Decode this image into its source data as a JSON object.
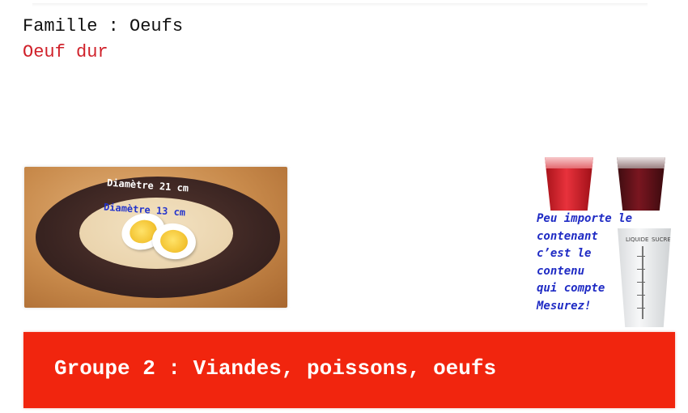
{
  "header": {
    "famille": "Famille : Oeufs",
    "recipe": "Oeuf dur"
  },
  "photo": {
    "diameter_outer": "Diamètre 21 cm",
    "diameter_inner": "Diamètre 13 cm",
    "cup_labels": [
      "LIQUIDE",
      "SUCRE"
    ]
  },
  "note": {
    "lines": [
      "Peu importe le",
      "contenant",
      "c’est le",
      "contenu",
      "qui compte",
      "Mesurez!"
    ]
  },
  "banner": {
    "text": "Groupe 2 : Viandes, poissons, oeufs"
  },
  "colors": {
    "recipe": "#d0212a",
    "note": "#1f2bc4",
    "banner": "#f1250e"
  }
}
